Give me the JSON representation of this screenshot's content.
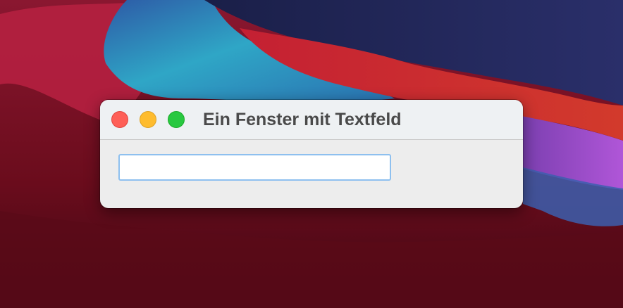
{
  "window": {
    "title": "Ein Fenster mit Textfeld",
    "controls": {
      "close_color": "#fe5f57",
      "minimize_color": "#febc2e",
      "zoom_color": "#28c840"
    },
    "text_field": {
      "value": "",
      "placeholder": ""
    }
  }
}
